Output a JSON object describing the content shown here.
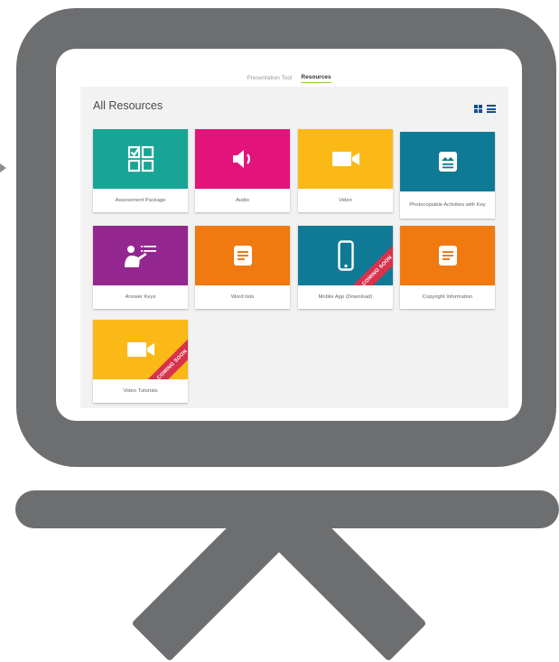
{
  "topnav": {
    "tabs": [
      "Presentation Tool",
      "Resources"
    ],
    "active_tab": "Resources"
  },
  "panel": {
    "title": "All Resources",
    "view_icons": [
      "grid-view-icon",
      "list-view-icon"
    ]
  },
  "tiles": [
    {
      "label": "Assessment Package",
      "color": "#19a596",
      "icon": "checklist-icon",
      "badge": ""
    },
    {
      "label": "Audio",
      "color": "#e2137a",
      "icon": "speaker-icon",
      "badge": ""
    },
    {
      "label": "Video",
      "color": "#fbb918",
      "icon": "video-camera-icon",
      "badge": ""
    },
    {
      "label": "Photocopiable Activities with Key",
      "color": "#0f7a96",
      "icon": "photo-document-icon",
      "badge": ""
    },
    {
      "label": "Answer Keys",
      "color": "#93278f",
      "icon": "presenter-icon",
      "badge": ""
    },
    {
      "label": "Word lists",
      "color": "#f07a10",
      "icon": "document-icon",
      "badge": ""
    },
    {
      "label": "Mobile App (Download)",
      "color": "#0f7a96",
      "icon": "mobile-phone-icon",
      "badge": "COMING SOON"
    },
    {
      "label": "Copyright Information",
      "color": "#f07a10",
      "icon": "document-icon",
      "badge": ""
    },
    {
      "label": "Video Tutorials",
      "color": "#fbb918",
      "icon": "video-camera-icon",
      "badge": "COMING SOON"
    }
  ],
  "colors": {
    "frame": "#6d6e70",
    "accent": "#8cc63f",
    "badge": "#d8324c"
  }
}
